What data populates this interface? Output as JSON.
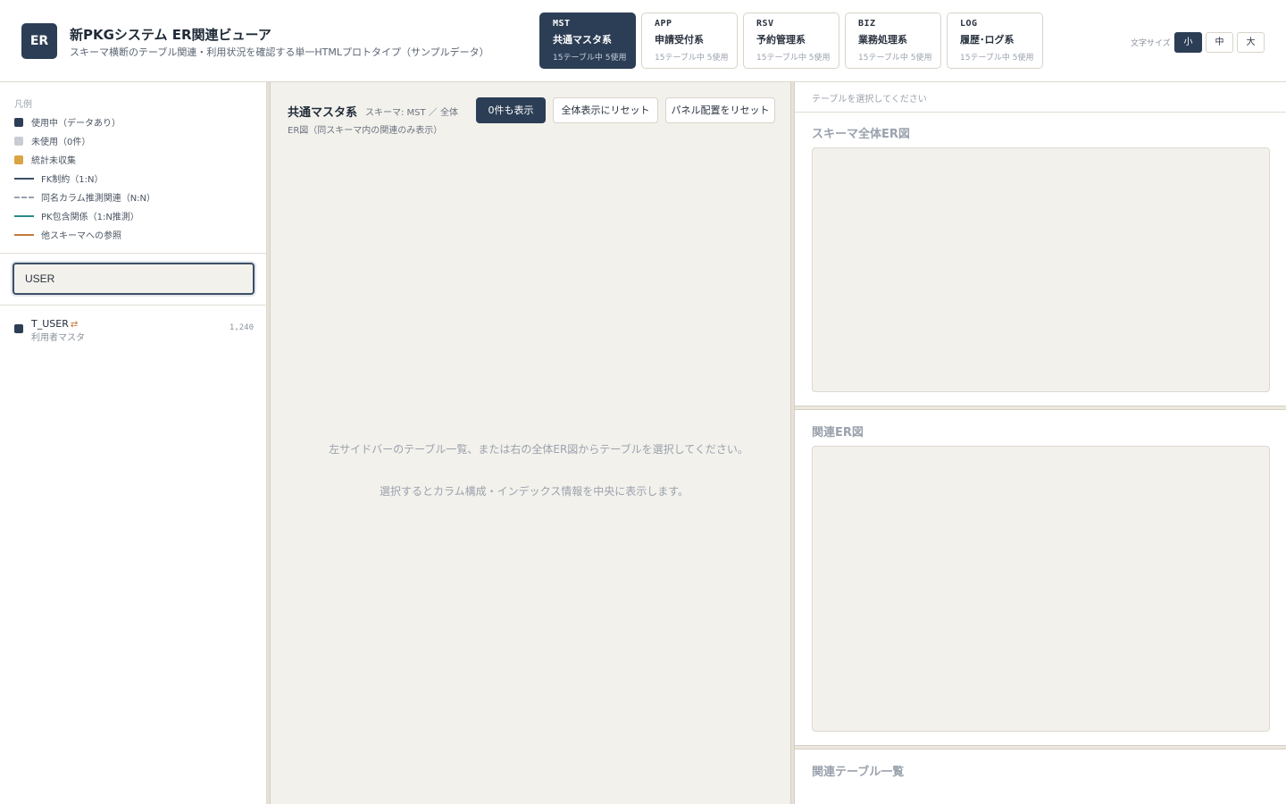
{
  "header": {
    "logo": "ER",
    "title": "新PKGシステム ER関連ビューア",
    "subtitle": "スキーマ横断のテーブル関連・利用状況を確認する単一HTMLプロトタイプ（サンプルデータ）",
    "tabs": [
      {
        "code": "MST",
        "name": "共通マスタ系",
        "meta": "15テーブル中 5使用",
        "active": true
      },
      {
        "code": "APP",
        "name": "申請受付系",
        "meta": "15テーブル中 5使用",
        "active": false
      },
      {
        "code": "RSV",
        "name": "予約管理系",
        "meta": "15テーブル中 5使用",
        "active": false
      },
      {
        "code": "BIZ",
        "name": "業務処理系",
        "meta": "15テーブル中 5使用",
        "active": false
      },
      {
        "code": "LOG",
        "name": "履歴･ログ系",
        "meta": "15テーブル中 5使用",
        "active": false
      }
    ],
    "font_size_label": "文字サイズ",
    "font_sizes": [
      "小",
      "中",
      "大"
    ],
    "font_size_selected": "小"
  },
  "sidebar": {
    "legend_title": "凡例",
    "legend": [
      {
        "label": "使用中（データあり）",
        "color": "#2c3e55",
        "kind": "square"
      },
      {
        "label": "未使用（0件）",
        "color": "#c9cdd3",
        "kind": "square"
      },
      {
        "label": "統計未収集",
        "color": "#d9a441",
        "kind": "square"
      },
      {
        "label": "FK制約（1:N）",
        "color": "#3c4f66",
        "kind": "solid-line"
      },
      {
        "label": "同名カラム推測関連（N:N）",
        "color": "#9aa2ad",
        "kind": "dashed-line"
      },
      {
        "label": "PK包含関係（1:N推測）",
        "color": "#2a8a8a",
        "kind": "solid-line"
      },
      {
        "label": "他スキーマへの参照",
        "color": "#c47a3a",
        "kind": "solid-line"
      }
    ],
    "search_value": "USER",
    "tables": [
      {
        "name": "T_USER",
        "jp_name": "利用者マスタ",
        "count": "1,240",
        "ref_icon": "cross-schema-ref-icon"
      }
    ]
  },
  "center": {
    "title": "共通マスタ系",
    "schema": "スキーマ: MST ／ 全体",
    "note": "ER図（同スキーマ内の関連のみ表示）",
    "buttons": {
      "show_zero": "0件も表示",
      "reset_all": "全体表示にリセット",
      "reset_panel": "パネル配置をリセット"
    },
    "empty_line1": "左サイドバーのテーブル一覧、または右の全体ER図からテーブルを選択してください。",
    "empty_line2": "選択するとカラム構成・インデックス情報を中央に表示します。"
  },
  "right": {
    "select_hint": "テーブルを選択してください",
    "schema_er_title": "スキーマ全体ER図",
    "related_er_title": "関連ER図",
    "related_list_title": "関連テーブル一覧"
  }
}
